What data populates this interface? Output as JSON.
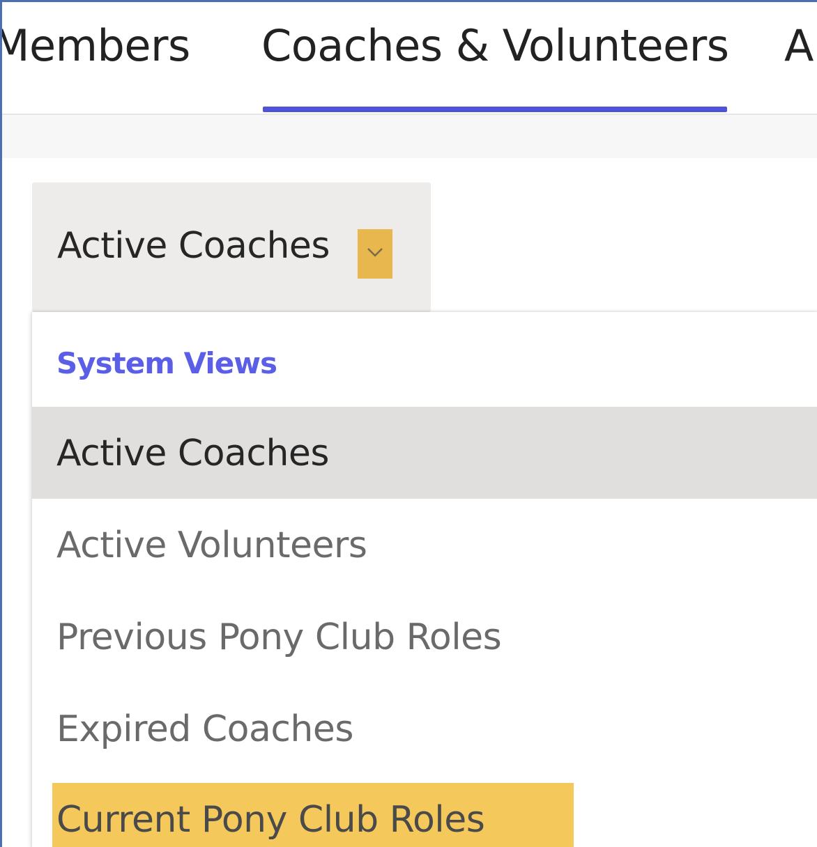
{
  "tabs": {
    "members_label": "Members",
    "coaches_label": "Coaches & Volunteers",
    "next_label": "A"
  },
  "view_selector": {
    "label": "Active Coaches",
    "accent_color": "#e8b84f"
  },
  "dropdown": {
    "section_header": "System Views",
    "items": [
      {
        "label": "Active Coaches",
        "state": "selected"
      },
      {
        "label": "Active Volunteers",
        "state": "normal"
      },
      {
        "label": "Previous Pony Club Roles",
        "state": "normal"
      },
      {
        "label": "Expired Coaches",
        "state": "normal"
      },
      {
        "label": "Current Pony Club Roles",
        "state": "highlighted"
      }
    ]
  },
  "colors": {
    "tab_underline": "#4f53d6",
    "section_header": "#5b5fe8",
    "highlight": "#f5c85c"
  }
}
